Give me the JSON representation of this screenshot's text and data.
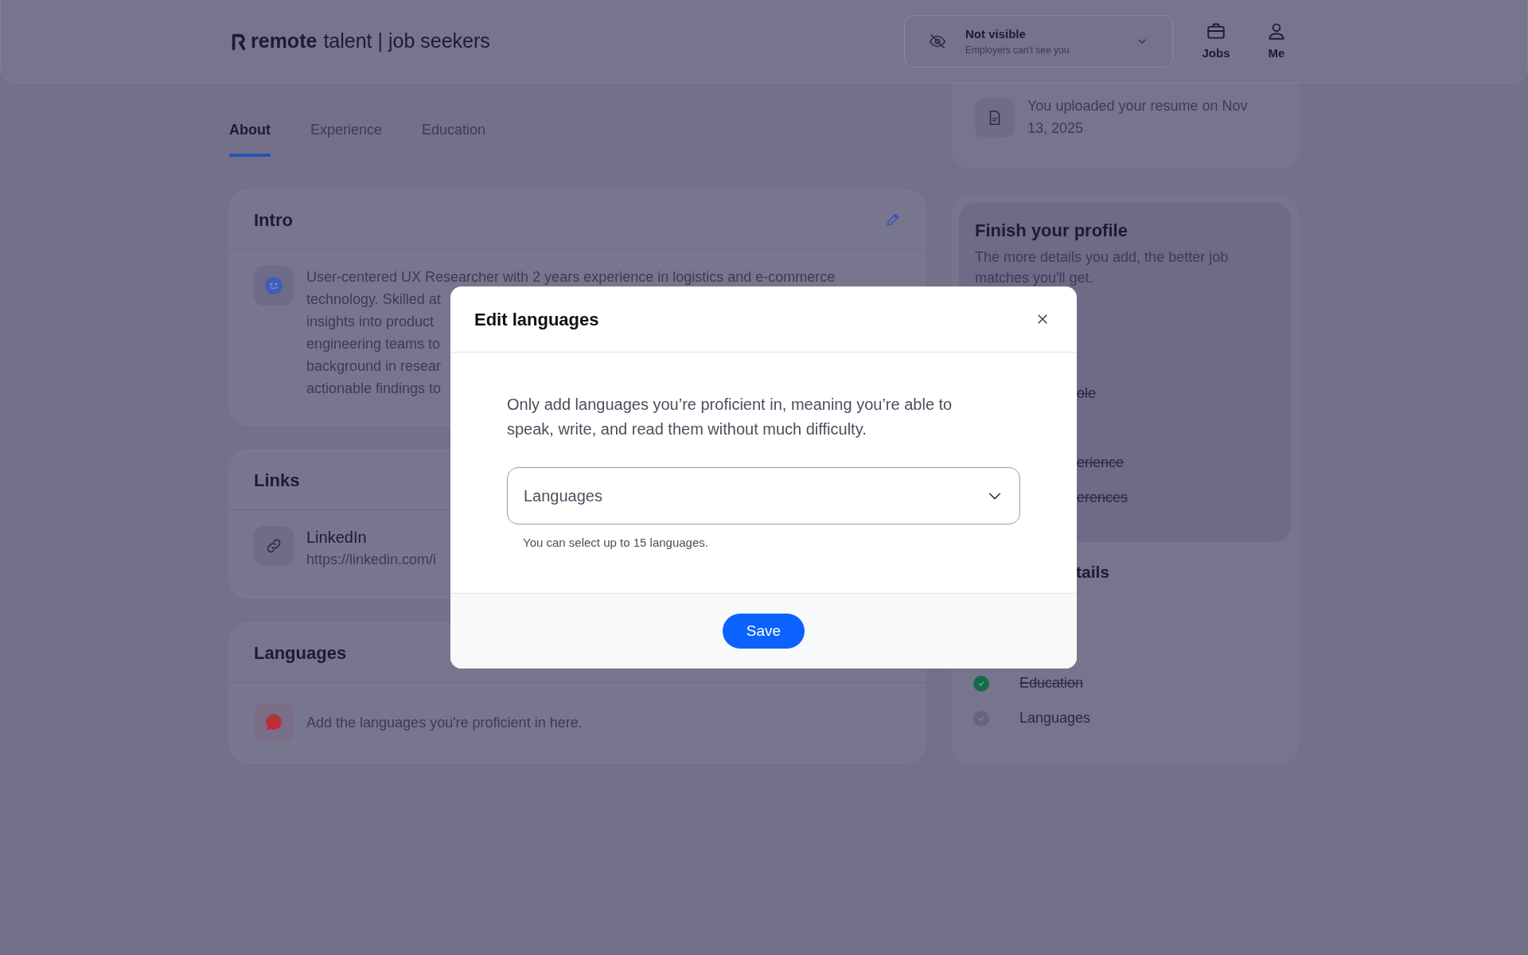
{
  "header": {
    "logo_bold": "remote",
    "logo_rest": "talent | job seekers",
    "visibility": {
      "title": "Not visible",
      "subtitle": "Employers can't see you"
    },
    "nav": [
      {
        "label": "Jobs",
        "kind": "jobs"
      },
      {
        "label": "Me",
        "kind": "me"
      }
    ]
  },
  "tabs": [
    {
      "label": "About",
      "selected": true
    },
    {
      "label": "Experience",
      "selected": false
    },
    {
      "label": "Education",
      "selected": false
    }
  ],
  "intro": {
    "title": "Intro",
    "lines": [
      "User-centered UX Researcher with 2 years experience in logistics and e-commerce",
      "technology. Skilled at",
      "insights into product",
      "engineering teams to",
      "background in resear",
      "actionable findings to"
    ]
  },
  "links": {
    "title": "Links",
    "items": [
      {
        "name": "LinkedIn",
        "url": "https://linkedin.com/i"
      }
    ]
  },
  "languages_card": {
    "title": "Languages",
    "text": "Add the languages you're proficient in here."
  },
  "resume": {
    "text": "You uploaded your resume on Nov 13, 2025"
  },
  "finish_profile": {
    "title": "Finish your profile",
    "text": "The more details you add, the better job matches you'll get.",
    "items": [
      {
        "label": "ole",
        "done": true
      },
      {
        "label": "erience",
        "done": true
      },
      {
        "label": "erences",
        "done": true
      }
    ]
  },
  "profile_details": {
    "title": "tails",
    "items": [
      {
        "label": "Education",
        "done": true
      },
      {
        "label": "Languages",
        "done": false
      }
    ]
  },
  "modal": {
    "title": "Edit languages",
    "text": "Only add languages you’re proficient in, meaning you’re able to speak, write, and read them without much difficulty.",
    "select": {
      "placeholder": "Languages"
    },
    "help": "You can select up to 15 languages.",
    "button": "Save"
  }
}
